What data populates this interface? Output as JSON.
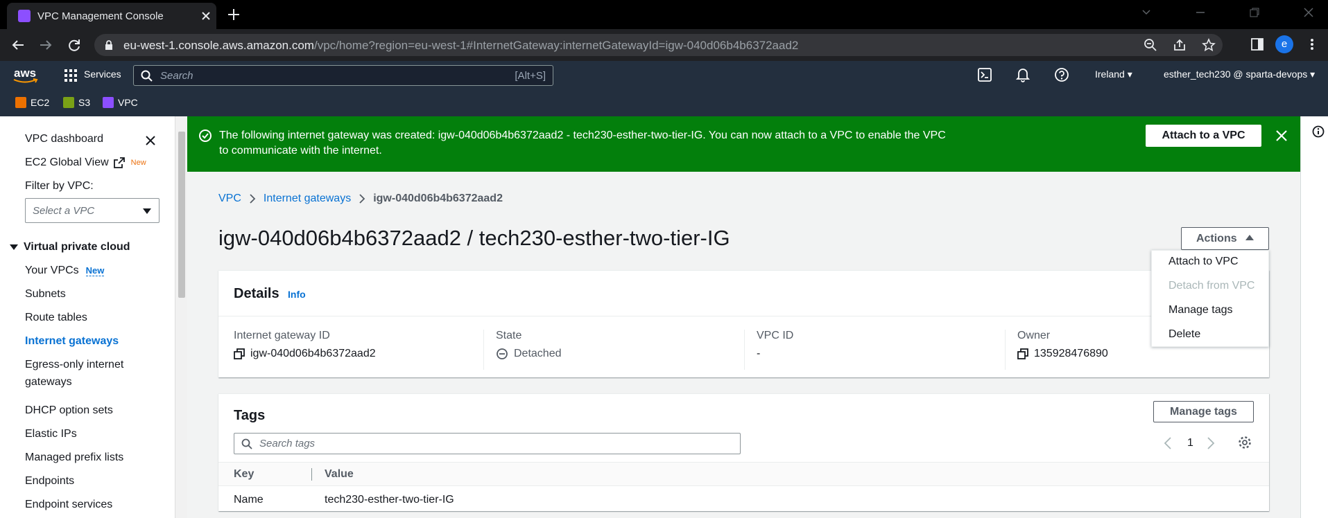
{
  "browser": {
    "tab_title": "VPC Management Console",
    "url_host": "eu-west-1.console.aws.amazon.com",
    "url_path": "/vpc/home?region=eu-west-1#InternetGateway:internetGatewayId=igw-040d06b4b6372aad2",
    "profile_initial": "e"
  },
  "aws_nav": {
    "logo": "aws",
    "services_label": "Services",
    "search_placeholder": "Search",
    "search_shortcut": "[Alt+S]",
    "region": "Ireland",
    "account": "esther_tech230 @ sparta-devops",
    "favorites": [
      {
        "label": "EC2",
        "color": "#ed7100"
      },
      {
        "label": "S3",
        "color": "#7aa116"
      },
      {
        "label": "VPC",
        "color": "#8c4fff"
      }
    ]
  },
  "sidenav": {
    "dashboard": "VPC dashboard",
    "global_view": "EC2 Global View",
    "global_view_badge": "New",
    "filter_label": "Filter by VPC:",
    "filter_placeholder": "Select a VPC",
    "section": "Virtual private cloud",
    "your_vpcs": "Your VPCs",
    "your_vpcs_badge": "New",
    "items": [
      "Subnets",
      "Route tables",
      "Internet gateways",
      "Egress-only internet",
      "gateways",
      "DHCP option sets",
      "Elastic IPs",
      "Managed prefix lists",
      "Endpoints",
      "Endpoint services"
    ]
  },
  "flash": {
    "message": "The following internet gateway was created: igw-040d06b4b6372aad2 - tech230-esther-two-tier-IG. You can now attach to a VPC to enable the VPC to communicate with the internet.",
    "button": "Attach to a VPC"
  },
  "breadcrumb": [
    "VPC",
    "Internet gateways",
    "igw-040d06b4b6372aad2"
  ],
  "page_title": "igw-040d06b4b6372aad2 / tech230-esther-two-tier-IG",
  "actions": {
    "label": "Actions",
    "menu": [
      {
        "label": "Attach to VPC",
        "disabled": false
      },
      {
        "label": "Detach from VPC",
        "disabled": true
      },
      {
        "label": "Manage tags",
        "disabled": false
      },
      {
        "label": "Delete",
        "disabled": false
      }
    ]
  },
  "details": {
    "heading": "Details",
    "info": "Info",
    "igw_label": "Internet gateway ID",
    "igw_value": "igw-040d06b4b6372aad2",
    "state_label": "State",
    "state_value": "Detached",
    "vpc_label": "VPC ID",
    "vpc_value": "-",
    "owner_label": "Owner",
    "owner_value": "135928476890"
  },
  "tags": {
    "heading": "Tags",
    "manage_button": "Manage tags",
    "search_placeholder": "Search tags",
    "page": "1",
    "col_key": "Key",
    "col_value": "Value",
    "rows": [
      {
        "key": "Name",
        "value": "tech230-esther-two-tier-IG"
      }
    ]
  }
}
